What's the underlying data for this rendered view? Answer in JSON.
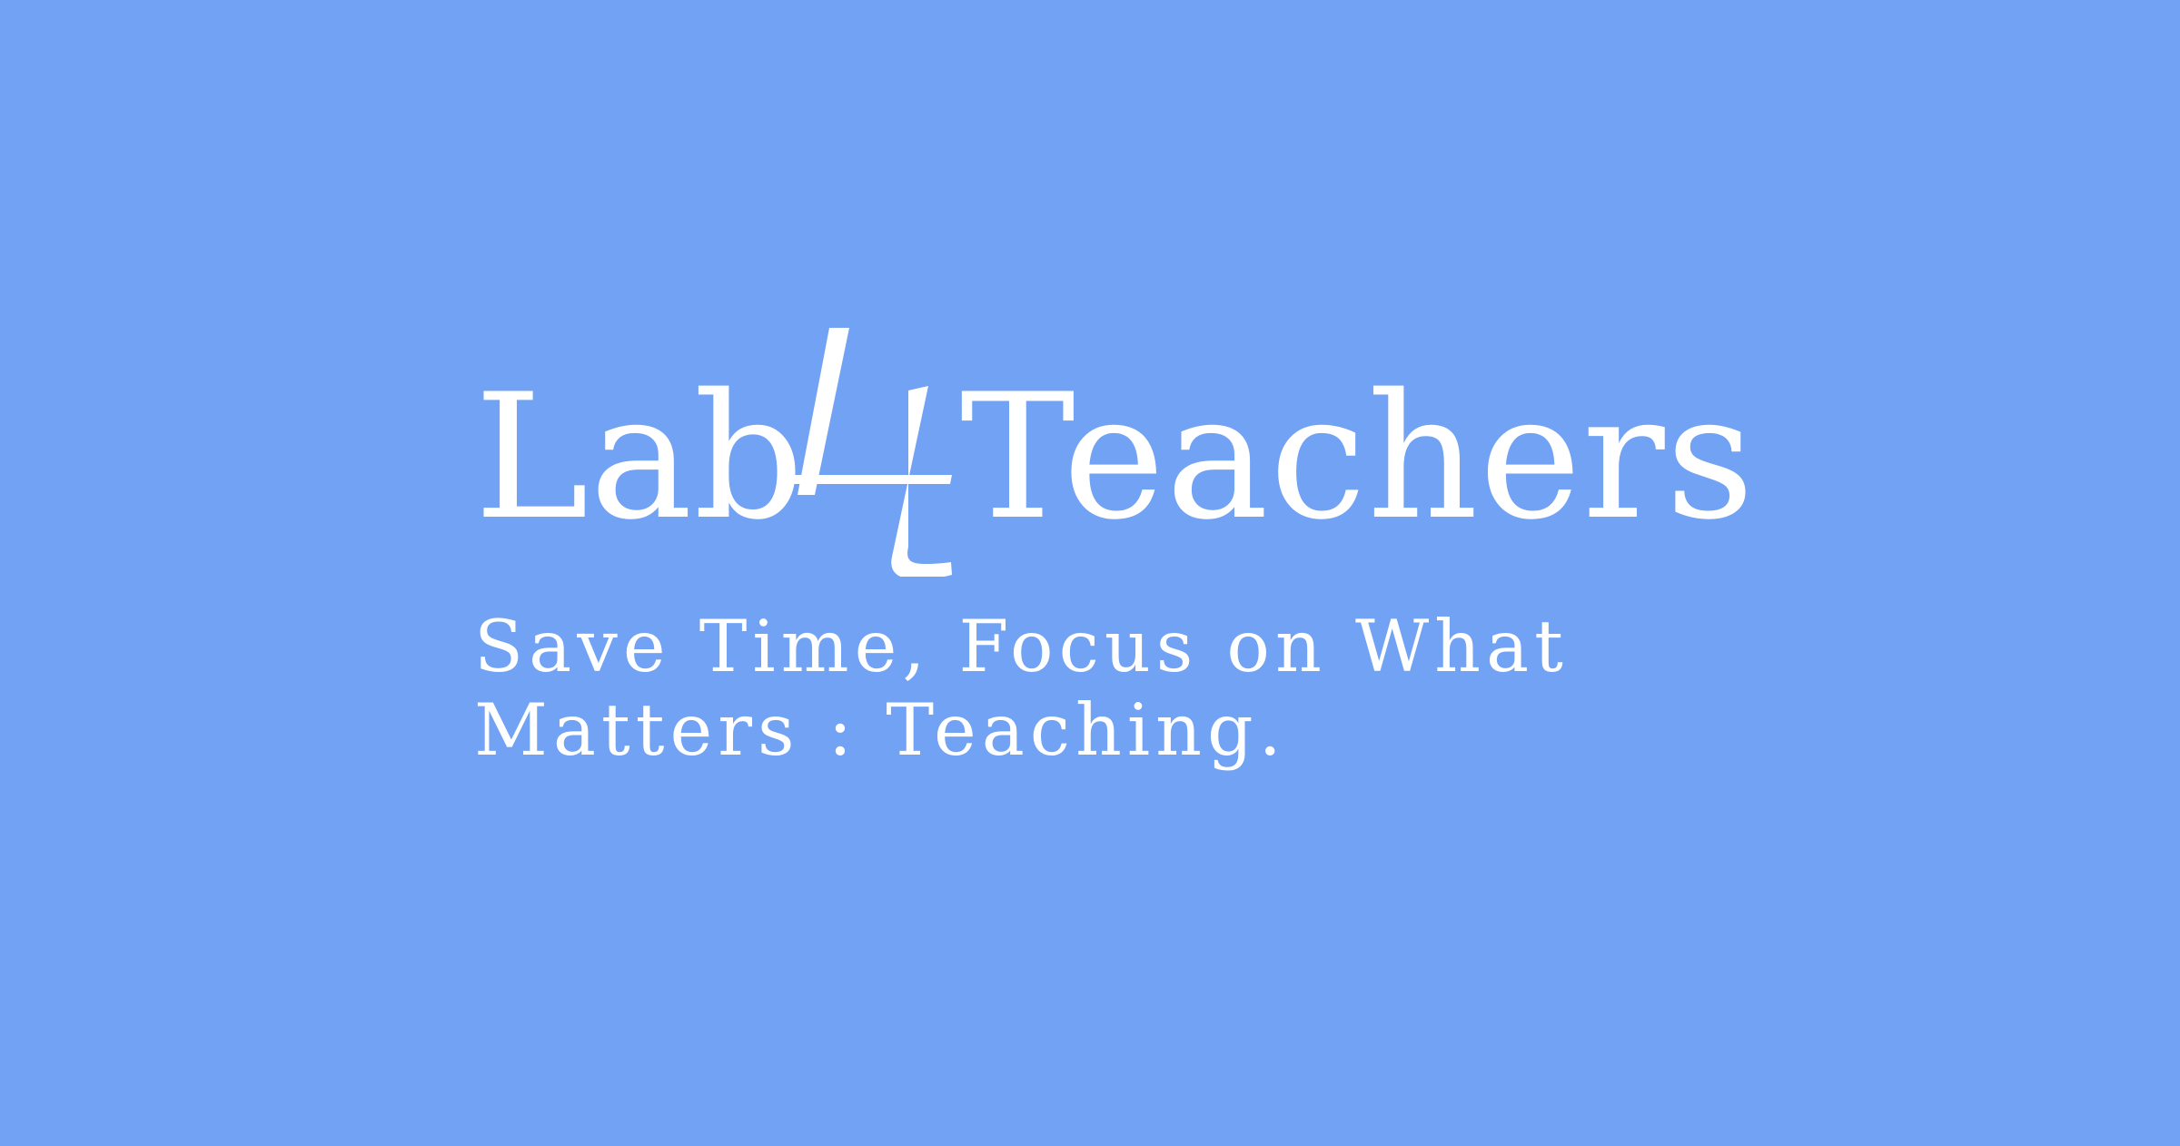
{
  "brand": {
    "name_part_1": "Lab",
    "name_part_2": "4",
    "name_part_3": "Teachers",
    "background_color": "#71a2f4",
    "text_color": "#ffffff"
  },
  "tagline": {
    "line_1": "Save Time, Focus on What",
    "line_2": "Matters : Teaching."
  }
}
